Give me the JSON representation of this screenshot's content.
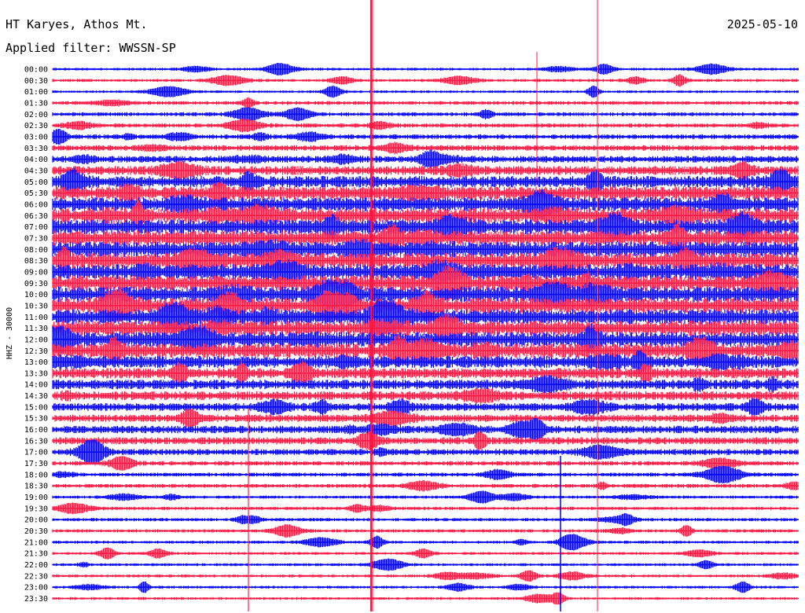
{
  "header": {
    "station": "HT Karyes, Athos Mt.",
    "date": "2025-05-10",
    "filter": "Applied filter: WWSSN-SP"
  },
  "chart_data": {
    "type": "line",
    "title": "HT Karyes, Athos Mt.",
    "subtitle": "Applied filter: WWSSN-SP",
    "date": "2025-05-10",
    "ylabel": "HHZ - 30000",
    "row_labels": [
      "00:00",
      "00:30",
      "01:00",
      "01:30",
      "02:00",
      "02:30",
      "03:00",
      "03:30",
      "04:00",
      "04:30",
      "05:00",
      "05:30",
      "06:00",
      "06:30",
      "07:00",
      "07:30",
      "08:00",
      "08:30",
      "09:00",
      "09:30",
      "10:00",
      "10:30",
      "11:00",
      "11:30",
      "12:00",
      "12:30",
      "13:00",
      "13:30",
      "14:00",
      "14:30",
      "15:00",
      "15:30",
      "16:00",
      "16:30",
      "17:00",
      "17:30",
      "18:00",
      "18:30",
      "19:00",
      "19:30",
      "20:00",
      "20:30",
      "21:00",
      "21:30",
      "22:00",
      "22:30",
      "23:00",
      "23:30"
    ],
    "trace_colors": [
      "#0000ff",
      "#ff1744"
    ],
    "activity_level": [
      0.06,
      0.08,
      0.05,
      0.12,
      0.14,
      0.16,
      0.2,
      0.26,
      0.34,
      0.5,
      0.7,
      0.8,
      0.86,
      0.9,
      0.92,
      0.94,
      0.95,
      0.96,
      0.96,
      0.96,
      0.96,
      0.95,
      0.94,
      0.93,
      0.92,
      0.88,
      0.72,
      0.6,
      0.55,
      0.5,
      0.42,
      0.4,
      0.4,
      0.38,
      0.3,
      0.18,
      0.14,
      0.14,
      0.09,
      0.1,
      0.1,
      0.1,
      0.08,
      0.07,
      0.07,
      0.07,
      0.06,
      0.06
    ],
    "grid": false
  }
}
